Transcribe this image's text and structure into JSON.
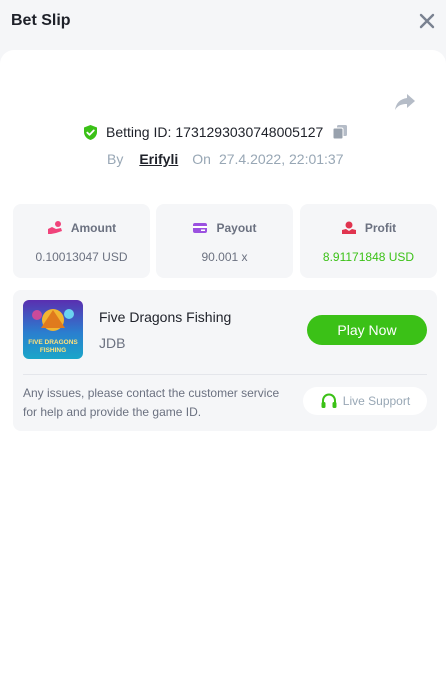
{
  "header": {
    "title": "Bet Slip"
  },
  "bet": {
    "id_label": "Betting ID:",
    "id_value": "1731293030748005127",
    "by_label": "By",
    "user": "Erifyli",
    "on_label": "On",
    "datetime": "27.4.2022, 22:01:37"
  },
  "stats": {
    "amount": {
      "label": "Amount",
      "value": "0.10013047 USD"
    },
    "payout": {
      "label": "Payout",
      "value": "90.001 x"
    },
    "profit": {
      "label": "Profit",
      "value": "8.91171848 USD"
    }
  },
  "game": {
    "name": "Five Dragons Fishing",
    "provider": "JDB",
    "play_label": "Play Now",
    "thumb_text_1": "FIVE DRAGONS",
    "thumb_text_2": "FISHING"
  },
  "support": {
    "issues_text": "Any issues, please contact the customer service for help and provide the game ID.",
    "button_label": "Live Support"
  },
  "colors": {
    "accent_green": "#3bc117",
    "amount_icon": "#f0437b",
    "payout_icon": "#9b51e0",
    "profit_icon": "#e0344f"
  },
  "icons": [
    "close-icon",
    "share-icon",
    "shield-check-icon",
    "copy-icon",
    "amount-icon",
    "payout-icon",
    "profit-icon",
    "headset-icon"
  ]
}
